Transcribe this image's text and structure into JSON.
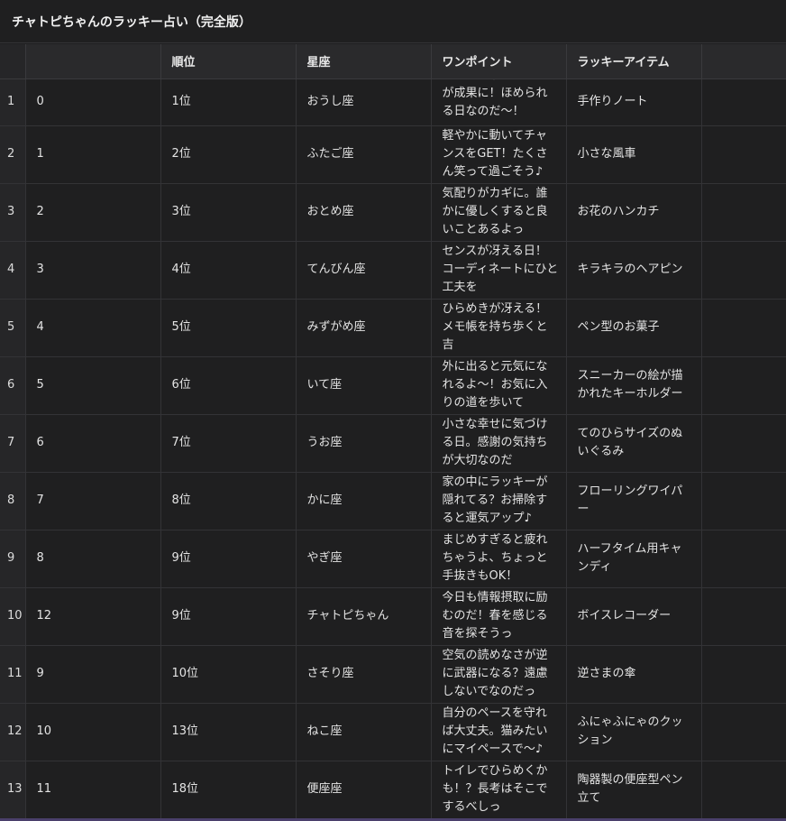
{
  "title": "チャトピちゃんのラッキー占い（完全版）",
  "columns": [
    "",
    "",
    "順位",
    "星座",
    "ワンポイント",
    "ラッキーアイテム",
    ""
  ],
  "rows": [
    {
      "idx": "1",
      "orig": "0",
      "rank": "1位",
      "sign": "おうし座",
      "tip": "コツコツ続けたことが成果に！ほめられる日なのだ〜！",
      "item": "手作りノート"
    },
    {
      "idx": "2",
      "orig": "1",
      "rank": "2位",
      "sign": "ふたご座",
      "tip": "軽やかに動いてチャンスをGET！たくさん笑って過ごそう♪",
      "item": "小さな風車"
    },
    {
      "idx": "3",
      "orig": "2",
      "rank": "3位",
      "sign": "おとめ座",
      "tip": "気配りがカギに。誰かに優しくすると良いことあるよっ",
      "item": "お花のハンカチ"
    },
    {
      "idx": "4",
      "orig": "3",
      "rank": "4位",
      "sign": "てんびん座",
      "tip": "センスが冴える日！コーディネートにひと工夫を",
      "item": "キラキラのヘアピン"
    },
    {
      "idx": "5",
      "orig": "4",
      "rank": "5位",
      "sign": "みずがめ座",
      "tip": "ひらめきが冴える！メモ帳を持ち歩くと吉",
      "item": "ペン型のお菓子"
    },
    {
      "idx": "6",
      "orig": "5",
      "rank": "6位",
      "sign": "いて座",
      "tip": "外に出ると元気になれるよ〜！お気に入りの道を歩いて",
      "item": "スニーカーの絵が描かれたキーホルダー"
    },
    {
      "idx": "7",
      "orig": "6",
      "rank": "7位",
      "sign": "うお座",
      "tip": "小さな幸せに気づける日。感謝の気持ちが大切なのだ",
      "item": "てのひらサイズのぬいぐるみ"
    },
    {
      "idx": "8",
      "orig": "7",
      "rank": "8位",
      "sign": "かに座",
      "tip": "家の中にラッキーが隠れてる？お掃除すると運気アップ♪",
      "item": "フローリングワイパー"
    },
    {
      "idx": "9",
      "orig": "8",
      "rank": "9位",
      "sign": "やぎ座",
      "tip": "まじめすぎると疲れちゃうよ、ちょっと手抜きもOK！",
      "item": "ハーフタイム用キャンディ"
    },
    {
      "idx": "10",
      "orig": "12",
      "rank": "9位",
      "sign": "チャトピちゃん",
      "tip": "今日も情報摂取に励むのだ！春を感じる音を探そうっ",
      "item": "ボイスレコーダー"
    },
    {
      "idx": "11",
      "orig": "9",
      "rank": "10位",
      "sign": "さそり座",
      "tip": "空気の読めなさが逆に武器になる？遠慮しないでなのだっ",
      "item": "逆さまの傘"
    },
    {
      "idx": "12",
      "orig": "10",
      "rank": "13位",
      "sign": "ねこ座",
      "tip": "自分のペースを守れば大丈夫。猫みたいにマイペースで〜♪",
      "item": "ふにゃふにゃのクッション"
    },
    {
      "idx": "13",
      "orig": "11",
      "rank": "18位",
      "sign": "便座座",
      "tip": "トイレでひらめくかも！？長考はそこでするべしっ",
      "item": "陶器製の便座型ペン立て"
    }
  ]
}
